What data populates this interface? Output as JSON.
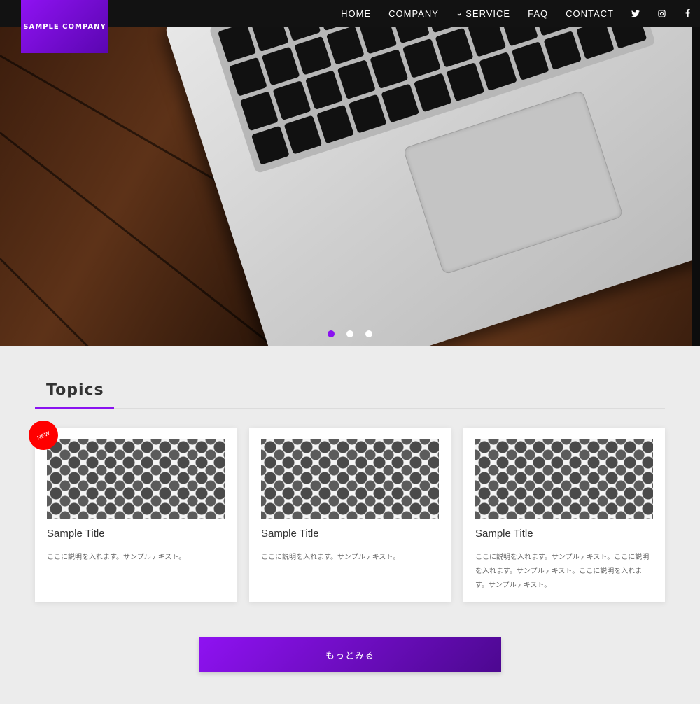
{
  "header": {
    "logo": "SAMPLE COMPANY",
    "nav": [
      {
        "label": "HOME"
      },
      {
        "label": "COMPANY"
      },
      {
        "label": "SERVICE",
        "icon": "double-chevron-down-icon"
      },
      {
        "label": "FAQ"
      },
      {
        "label": "CONTACT"
      }
    ],
    "social_icons": [
      "twitter-icon",
      "instagram-icon",
      "facebook-icon"
    ]
  },
  "hero": {
    "slides_total": 3,
    "active_slide": 1
  },
  "topics": {
    "heading": "Topics",
    "badge": "NEW",
    "cards": [
      {
        "title": "Sample Title",
        "description": "ここに説明を入れます。サンプルテキスト。"
      },
      {
        "title": "Sample Title",
        "description": "ここに説明を入れます。サンプルテキスト。"
      },
      {
        "title": "Sample Title",
        "description": "ここに説明を入れます。サンプルテキスト。ここに説明を入れます。サンプルテキスト。ここに説明を入れます。サンプルテキスト。"
      }
    ],
    "more_button": "もっとみる"
  },
  "colors": {
    "accent": "#8a12f0",
    "header_bg": "#121212",
    "page_bg": "#ececec",
    "badge": "#ff0000"
  }
}
